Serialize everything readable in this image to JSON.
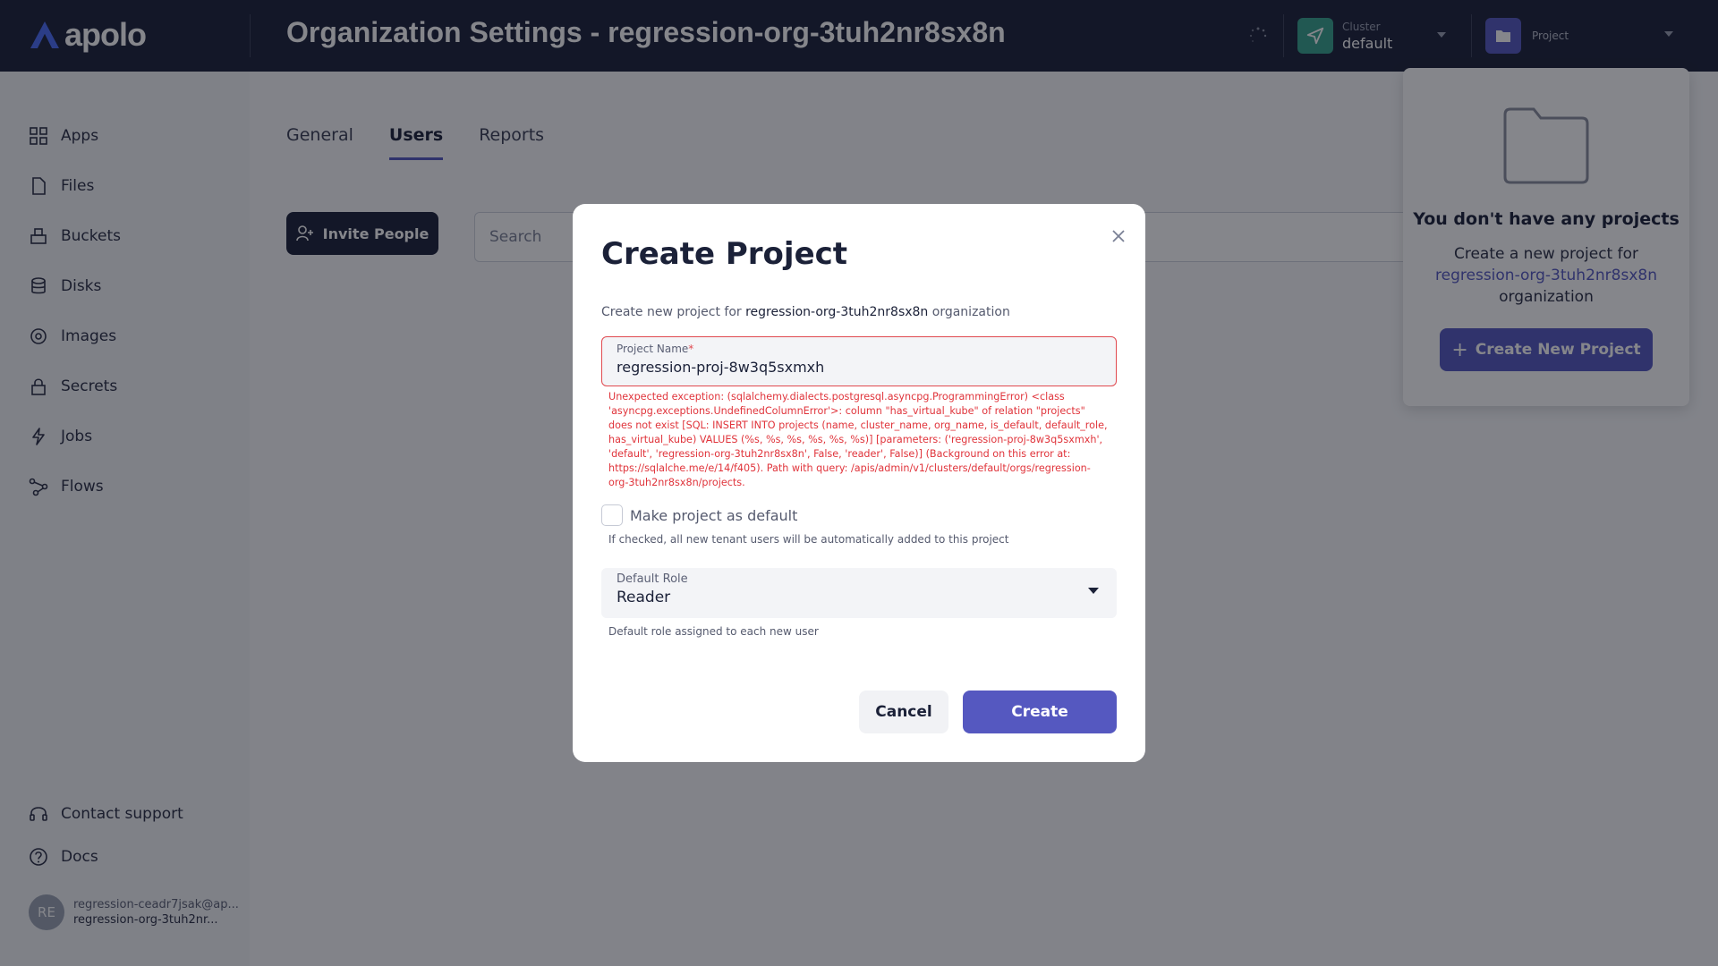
{
  "app": {
    "brand": "apolo"
  },
  "header": {
    "title": "Organization Settings - regression-org-3tuh2nr8sx8n",
    "cluster": {
      "label": "Cluster",
      "value": "default"
    },
    "project": {
      "label": "Project"
    }
  },
  "sidebar": {
    "items": [
      {
        "label": "Apps",
        "icon": "apps-icon"
      },
      {
        "label": "Files",
        "icon": "file-icon"
      },
      {
        "label": "Buckets",
        "icon": "bucket-icon"
      },
      {
        "label": "Disks",
        "icon": "database-icon"
      },
      {
        "label": "Images",
        "icon": "image-icon"
      },
      {
        "label": "Secrets",
        "icon": "lock-icon"
      },
      {
        "label": "Jobs",
        "icon": "lightning-icon"
      },
      {
        "label": "Flows",
        "icon": "flow-icon"
      }
    ],
    "footer": [
      {
        "label": "Contact support",
        "icon": "headset-icon"
      },
      {
        "label": "Docs",
        "icon": "help-icon"
      }
    ],
    "user": {
      "initials": "RE",
      "email": "regression-ceadr7jsak@ap...",
      "org": "regression-org-3tuh2nr..."
    }
  },
  "main": {
    "tabs": [
      {
        "label": "General",
        "active": false
      },
      {
        "label": "Users",
        "active": true
      },
      {
        "label": "Reports",
        "active": false
      }
    ],
    "invite_label": "Invite People",
    "search_placeholder": "Search"
  },
  "project_popup": {
    "empty_title": "You don't have any projects",
    "empty_desc_prefix": "Create a new project for",
    "empty_desc_org": "regression-org-3tuh2nr8sx8n",
    "empty_desc_suffix": "organization",
    "create_label": "Create New Project"
  },
  "modal": {
    "title": "Create Project",
    "subtitle_prefix": "Create new project for",
    "subtitle_org": "regression-org-3tuh2nr8sx8n",
    "subtitle_suffix": "organization",
    "project_name": {
      "label": "Project Name",
      "required_mark": "*",
      "value": "regression-proj-8w3q5sxmxh"
    },
    "error": "Unexpected exception: (sqlalchemy.dialects.postgresql.asyncpg.ProgrammingError) <class 'asyncpg.exceptions.UndefinedColumnError'>: column \"has_virtual_kube\" of relation \"projects\" does not exist [SQL: INSERT INTO projects (name, cluster_name, org_name, is_default, default_role, has_virtual_kube) VALUES (%s, %s, %s, %s, %s, %s)] [parameters: ('regression-proj-8w3q5sxmxh', 'default', 'regression-org-3tuh2nr8sx8n', False, 'reader', False)] (Background on this error at: https://sqlalche.me/e/14/f405). Path with query: /apis/admin/v1/clusters/default/orgs/regression-org-3tuh2nr8sx8n/projects.",
    "default_checkbox": {
      "label": "Make project as default",
      "help": "If checked, all new tenant users will be automatically added to this project",
      "checked": false
    },
    "default_role": {
      "label": "Default Role",
      "value": "Reader",
      "help": "Default role assigned to each new user"
    },
    "cancel_label": "Cancel",
    "create_label": "Create"
  },
  "colors": {
    "accent": "#5558c0",
    "header_bg": "#1b2138",
    "error": "#e0343b",
    "cluster_badge": "#37a38d"
  }
}
